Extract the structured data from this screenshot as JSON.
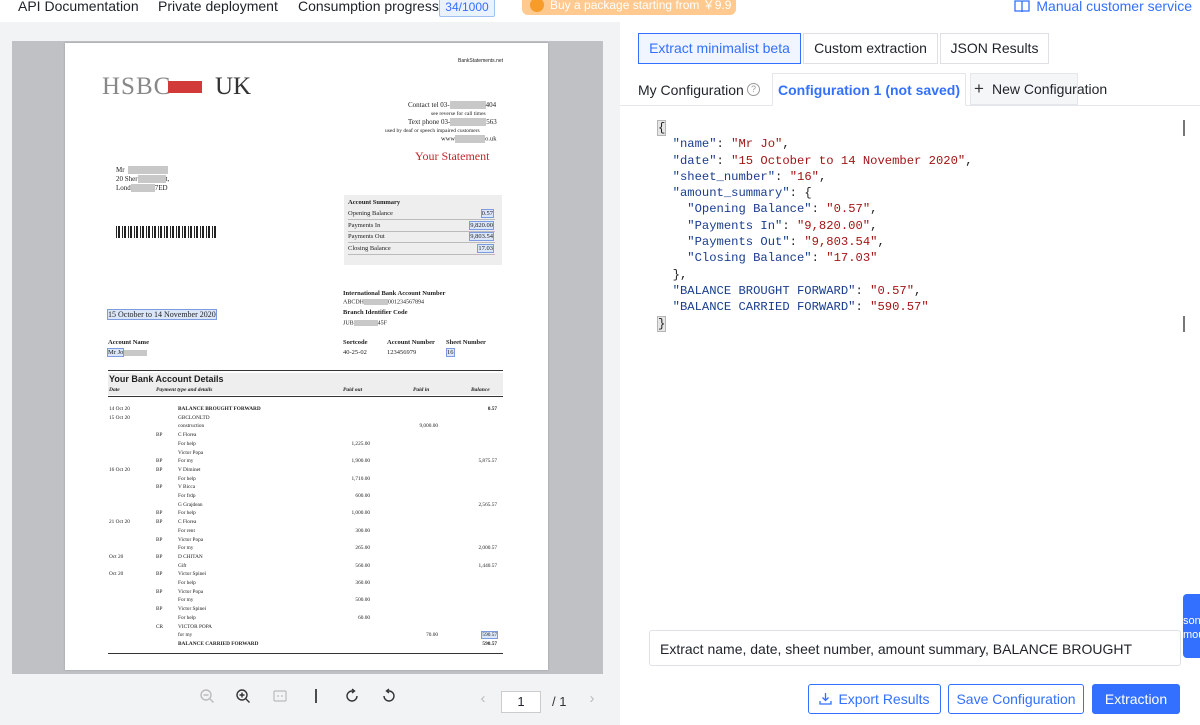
{
  "topbar": {
    "api_docs": "API Documentation",
    "private_deploy": "Private deployment",
    "consumption": "Consumption progress",
    "consumption_count": "34/1000",
    "promo": "Buy a package starting from ￥9.9",
    "service": "Manual customer service",
    "accent": "#3370ff"
  },
  "doc": {
    "bank_left": "HSBC",
    "bank_right": "UK",
    "watermark": "BankStatements.net",
    "contact_tel": "Contact tel 03-",
    "contact_tel_end": "404",
    "reverse_note": "see reverse for call times",
    "text_phone": "Text phone 03-",
    "text_phone_end": "563",
    "deaf_note": "used by deaf or speech impaired customers",
    "web": "www",
    "web_end": "o.uk",
    "your_statement": "Your Statement",
    "addr1": "Mr",
    "addr2": "20 Sher",
    "addr2_end": "t,",
    "addr3": "Lond",
    "addr3_end": "7ED",
    "summary_title": "Account Summary",
    "summary": [
      {
        "label": "Opening Balance",
        "value": "0.57"
      },
      {
        "label": "Payments In",
        "value": "9,820.00"
      },
      {
        "label": "Payments Out",
        "value": "9,803.54"
      },
      {
        "label": "Closing Balance",
        "value": "17.03"
      }
    ],
    "date_range": "15 October to 14 November 2020",
    "iban_title": "International Bank Account Number",
    "iban": "ABCDH",
    "iban_end": "001234567894",
    "bic_title": "Branch Identifier Code",
    "bic": "JUB",
    "bic_end": "45F",
    "account_name_label": "Account Name",
    "account_name": "Mr Jo",
    "sortcode_label": "Sortcode",
    "sortcode": "40-25-02",
    "acc_num_label": "Account Number",
    "acc_num": "123456979",
    "sheet_label": "Sheet Number",
    "sheet": "16",
    "details_title": "Your Bank Account Details",
    "col_date": "Date",
    "col_payment": "Payment type and details",
    "col_paid_out": "Paid out",
    "col_paid_in": "Paid in",
    "col_balance": "Balance",
    "rows": [
      {
        "date": "14 Oct 20",
        "type": "",
        "detail": "BALANCE BROUGHT FORWARD",
        "out": "",
        "in": "",
        "bal": "0.57",
        "bold": true
      },
      {
        "date": "15 Oct 20",
        "type": "",
        "detail": "GBCLONLTD",
        "out": "",
        "in": "",
        "bal": ""
      },
      {
        "date": "",
        "type": "",
        "detail": "construction",
        "out": "",
        "in": "9,000.00",
        "bal": ""
      },
      {
        "date": "",
        "type": "BP",
        "detail": "C Florea",
        "out": "",
        "in": "",
        "bal": ""
      },
      {
        "date": "",
        "type": "",
        "detail": "For help",
        "out": "1,225.00",
        "in": "",
        "bal": ""
      },
      {
        "date": "",
        "type": "",
        "detail": "Victor Popa",
        "out": "",
        "in": "",
        "bal": ""
      },
      {
        "date": "",
        "type": "BP",
        "detail": "For my",
        "out": "1,900.00",
        "in": "",
        "bal": "5,875.57"
      },
      {
        "date": "16 Oct 20",
        "type": "BP",
        "detail": "V Diminet",
        "out": "",
        "in": "",
        "bal": ""
      },
      {
        "date": "",
        "type": "",
        "detail": "For help",
        "out": "1,710.00",
        "in": "",
        "bal": ""
      },
      {
        "date": "",
        "type": "BP",
        "detail": "V Bicca",
        "out": "",
        "in": "",
        "bal": ""
      },
      {
        "date": "",
        "type": "",
        "detail": "For frdp",
        "out": "600.00",
        "in": "",
        "bal": ""
      },
      {
        "date": "",
        "type": "",
        "detail": "G Grajdean",
        "out": "",
        "in": "",
        "bal": "2,565.57"
      },
      {
        "date": "",
        "type": "BP",
        "detail": "For help",
        "out": "1,000.00",
        "in": "",
        "bal": ""
      },
      {
        "date": "21 Oct 20",
        "type": "BP",
        "detail": "C Florea",
        "out": "",
        "in": "",
        "bal": ""
      },
      {
        "date": "",
        "type": "",
        "detail": "For rent",
        "out": "300.00",
        "in": "",
        "bal": ""
      },
      {
        "date": "",
        "type": "BP",
        "detail": "Victor Popa",
        "out": "",
        "in": "",
        "bal": ""
      },
      {
        "date": "",
        "type": "",
        "detail": "For my",
        "out": "265.00",
        "in": "",
        "bal": "2,000.57"
      },
      {
        "date": "Oct 20",
        "type": "BP",
        "detail": "D CHITAN",
        "out": "",
        "in": "",
        "bal": ""
      },
      {
        "date": "",
        "type": "",
        "detail": "Gift",
        "out": "560.00",
        "in": "",
        "bal": "1,440.57"
      },
      {
        "date": "Oct 20",
        "type": "BP",
        "detail": "Victor Spinei",
        "out": "",
        "in": "",
        "bal": ""
      },
      {
        "date": "",
        "type": "",
        "detail": "For help",
        "out": "360.00",
        "in": "",
        "bal": ""
      },
      {
        "date": "",
        "type": "BP",
        "detail": "Victor Popa",
        "out": "",
        "in": "",
        "bal": ""
      },
      {
        "date": "",
        "type": "",
        "detail": "For my",
        "out": "500.00",
        "in": "",
        "bal": ""
      },
      {
        "date": "",
        "type": "BP",
        "detail": "Victor Spinei",
        "out": "",
        "in": "",
        "bal": ""
      },
      {
        "date": "",
        "type": "",
        "detail": "For help",
        "out": "60.00",
        "in": "",
        "bal": ""
      },
      {
        "date": "",
        "type": "CR",
        "detail": "VICTOR POPA",
        "out": "",
        "in": "",
        "bal": ""
      },
      {
        "date": "",
        "type": "",
        "detail": "for my",
        "out": "",
        "in": "70.00",
        "bal": "590.57",
        "hl": true
      },
      {
        "date": "",
        "type": "",
        "detail": "BALANCE CARRIED FORWARD",
        "out": "",
        "in": "",
        "bal": "590.57",
        "bold": true
      }
    ]
  },
  "viewer": {
    "page_current": "1",
    "page_total": "/ 1"
  },
  "tabs": {
    "minimalist": "Extract minimalist beta",
    "custom": "Custom extraction",
    "json": "JSON Results"
  },
  "config": {
    "my_config": "My Configuration",
    "active": "Configuration 1 (not saved)",
    "new": "New Configuration"
  },
  "json_lines": [
    {
      "text": "{",
      "kind": "bracket"
    },
    {
      "key": "\"name\"",
      "val": "\"Mr Jo\"",
      "tail": ",",
      "indent": 1
    },
    {
      "key": "\"date\"",
      "val": "\"15 October to 14 November 2020\"",
      "tail": ",",
      "indent": 1
    },
    {
      "key": "\"sheet_number\"",
      "val": "\"16\"",
      "tail": ",",
      "indent": 1
    },
    {
      "key": "\"amount_summary\"",
      "val": "",
      "tail": "{",
      "indent": 1
    },
    {
      "key": "\"Opening Balance\"",
      "val": "\"0.57\"",
      "tail": ",",
      "indent": 2
    },
    {
      "key": "\"Payments In\"",
      "val": "\"9,820.00\"",
      "tail": ",",
      "indent": 2
    },
    {
      "key": "\"Payments Out\"",
      "val": "\"9,803.54\"",
      "tail": ",",
      "indent": 2
    },
    {
      "key": "\"Closing Balance\"",
      "val": "\"17.03\"",
      "tail": "",
      "indent": 2
    },
    {
      "text": "},",
      "kind": "plain",
      "indent": 1
    },
    {
      "key": "\"BALANCE BROUGHT FORWARD\"",
      "val": "\"0.57\"",
      "tail": ",",
      "indent": 1
    },
    {
      "key": "\"BALANCE CARRIED FORWARD\"",
      "val": "\"590.57\"",
      "tail": "",
      "indent": 1
    },
    {
      "text": "}",
      "kind": "bracket"
    }
  ],
  "prompt": "Extract name, date, sheet number, amount summary, BALANCE BROUGHT",
  "side_tab": "son mou",
  "buttons": {
    "export": "Export Results",
    "save": "Save Configuration",
    "extract": "Extraction"
  }
}
